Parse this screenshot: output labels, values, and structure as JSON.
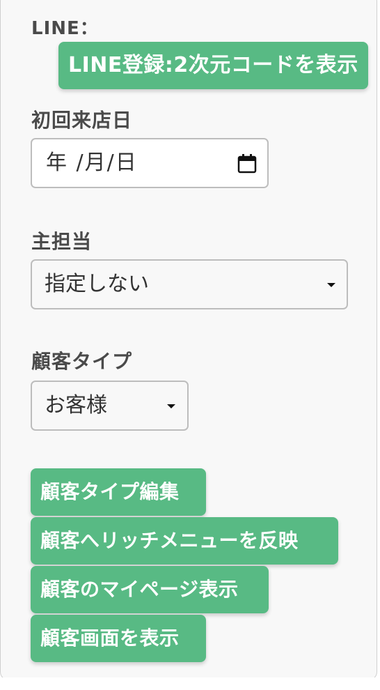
{
  "line_section": {
    "label": "LINE：",
    "register_button": "LINE登録:2次元コードを表示"
  },
  "first_visit": {
    "label": "初回来店日",
    "date_value": "年 /月/日"
  },
  "main_staff": {
    "label": "主担当",
    "selected": "指定しない"
  },
  "customer_type": {
    "label": "顧客タイプ",
    "selected": "お客様"
  },
  "actions": {
    "edit_type": "顧客タイプ編集",
    "apply_richmenu": "顧客へリッチメニューを反映",
    "show_mypage": "顧客のマイページ表示",
    "show_customer_screen": "顧客画面を表示"
  },
  "colors": {
    "accent": "#58ba84",
    "label_text": "#4a4a4a"
  }
}
